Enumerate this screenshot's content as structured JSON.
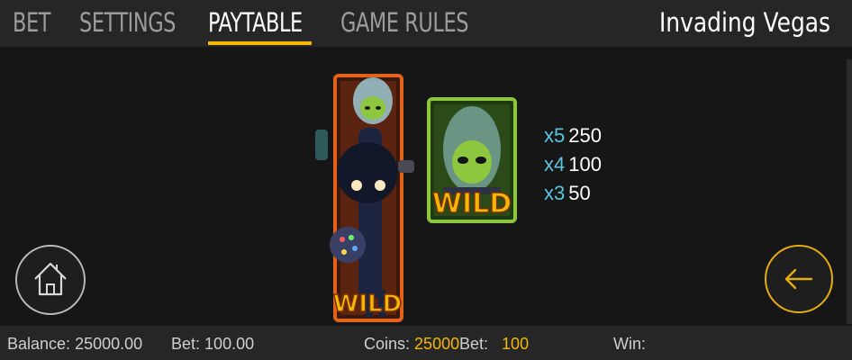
{
  "nav": {
    "tabs": [
      {
        "label": "BET",
        "active": false
      },
      {
        "label": "SETTINGS",
        "active": false
      },
      {
        "label": "PAYTABLE",
        "active": true
      },
      {
        "label": "GAME RULES",
        "active": false
      }
    ],
    "game_title": "Invading Vegas"
  },
  "paytable": {
    "symbol_text": "WILD",
    "payouts": [
      {
        "mult": "x5",
        "value": "250"
      },
      {
        "mult": "x4",
        "value": "100"
      },
      {
        "mult": "x3",
        "value": "50"
      }
    ]
  },
  "status": {
    "balance_label": "Balance:",
    "balance_value": "25000.00",
    "bet_label": "Bet:",
    "bet_value": "100.00",
    "coins_label": "Coins:",
    "coins_value": "25000",
    "coinbet_label": "Bet:",
    "coinbet_value": "100",
    "win_label": "Win:",
    "win_value": ""
  },
  "colors": {
    "accent": "#f5b800",
    "multiplier": "#59c6e0",
    "wild_frame_tall": "#e2621a",
    "wild_frame_small": "#8cc63f"
  },
  "icons": {
    "home": "home-icon",
    "back": "arrow-left-icon"
  }
}
